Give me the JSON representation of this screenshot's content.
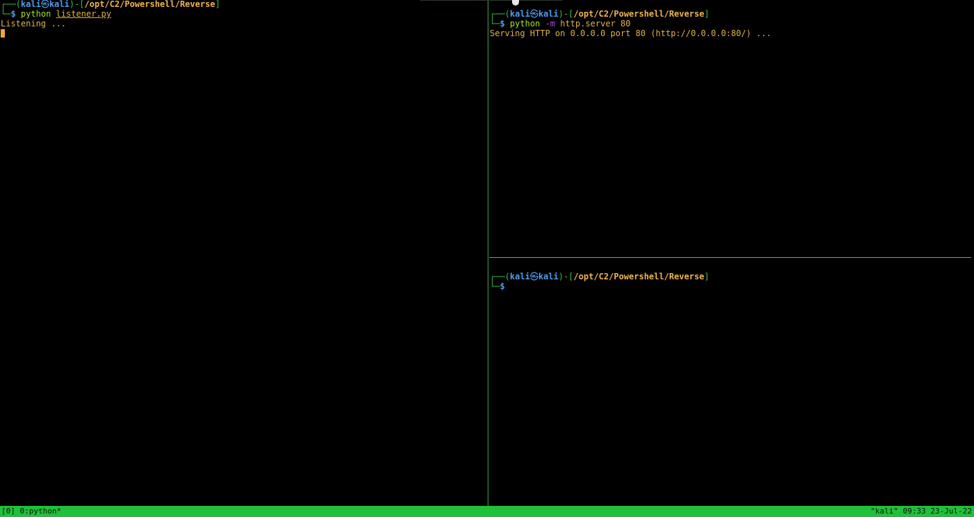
{
  "colors": {
    "background": "#000000",
    "status_bar": "#1fc13a",
    "vertical_split": "#3aa858",
    "horizontal_split": "#c8863c",
    "prompt_blue": "#4f9ff0",
    "prompt_path": "#f0b450",
    "command_green": "#a6e22e",
    "output_amber": "#e0b34c",
    "flag_purple": "#b04ad8",
    "cursor": "#f0a830"
  },
  "panes": {
    "left": {
      "prompt": {
        "corner_top": "┌──(",
        "user": "kali",
        "at_symbol": "㉿",
        "host": "kali",
        "sep": ")-[",
        "path": "/opt/C2/Powershell/Reverse",
        "close": "]",
        "corner_bottom": "└─",
        "dollar": "$"
      },
      "command": {
        "program": "python",
        "arg": "listener.py"
      },
      "output": "Listening ..."
    },
    "top_right": {
      "prompt": {
        "corner_top": "┌──(",
        "user": "kali",
        "at_symbol": "㉿",
        "host": "kali",
        "sep": ")-[",
        "path": "/opt/C2/Powershell/Reverse",
        "close": "]",
        "corner_bottom": "└─",
        "dollar": "$"
      },
      "command": {
        "program": "python",
        "flag": "-m",
        "module": "http.server",
        "port": "80"
      },
      "output": "Serving HTTP on 0.0.0.0 port 80 (http://0.0.0.0:80/) ..."
    },
    "bottom_right": {
      "prompt": {
        "corner_top": "┌──(",
        "user": "kali",
        "at_symbol": "㉿",
        "host": "kali",
        "sep": ")-[",
        "path": "/opt/C2/Powershell/Reverse",
        "close": "]",
        "corner_bottom": "└─",
        "dollar": "$"
      }
    }
  },
  "status_bar": {
    "left": "[0] 0:python*",
    "right": "\"kali\" 09:33 23-Jul-22"
  }
}
